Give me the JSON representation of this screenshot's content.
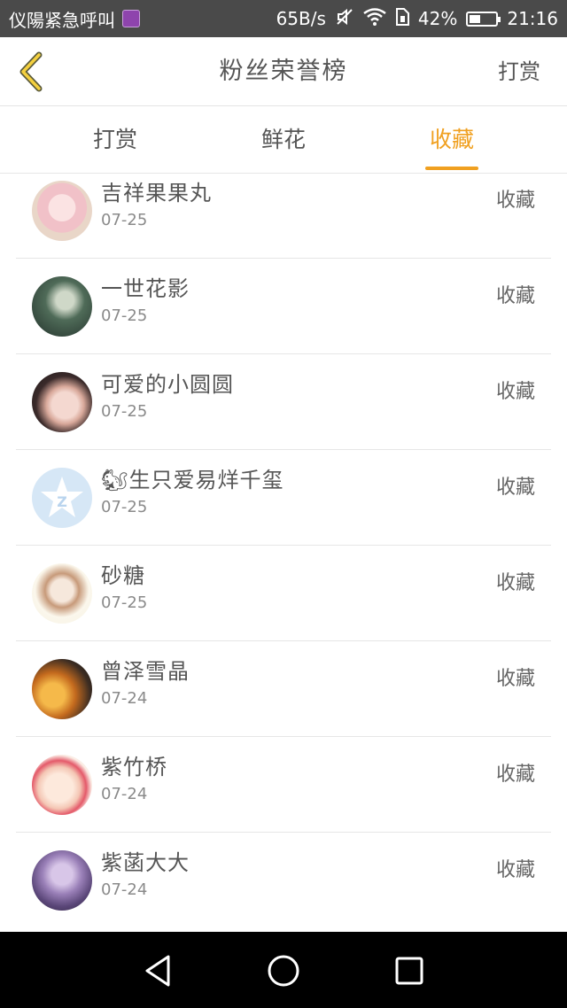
{
  "status_bar": {
    "left_text": "仪陽紧急呼叫",
    "speed": "65B/s",
    "battery_pct": "42%",
    "battery_level": 0.42,
    "time": "21:16"
  },
  "header": {
    "title": "粉丝荣誉榜",
    "right_label": "打赏"
  },
  "tabs": [
    {
      "label": "打赏"
    },
    {
      "label": "鲜花"
    },
    {
      "label": "收藏"
    }
  ],
  "active_tab_index": 2,
  "accent_color": "#f0a020",
  "list": [
    {
      "name": "吉祥果果丸",
      "date": "07-25",
      "action": "收藏"
    },
    {
      "name": "一世花影",
      "date": "07-25",
      "action": "收藏"
    },
    {
      "name": "可爱的小圆圆",
      "date": "07-25",
      "action": "收藏"
    },
    {
      "name": "🐿生只爱易烊千玺",
      "date": "07-25",
      "action": "收藏"
    },
    {
      "name": "砂糖",
      "date": "07-25",
      "action": "收藏"
    },
    {
      "name": "曾泽雪晶",
      "date": "07-24",
      "action": "收藏"
    },
    {
      "name": "紫竹桥",
      "date": "07-24",
      "action": "收藏"
    },
    {
      "name": "紫菡大大",
      "date": "07-24",
      "action": "收藏"
    }
  ],
  "nav_icons": [
    "back-triangle-icon",
    "home-circle-icon",
    "recent-square-icon"
  ]
}
